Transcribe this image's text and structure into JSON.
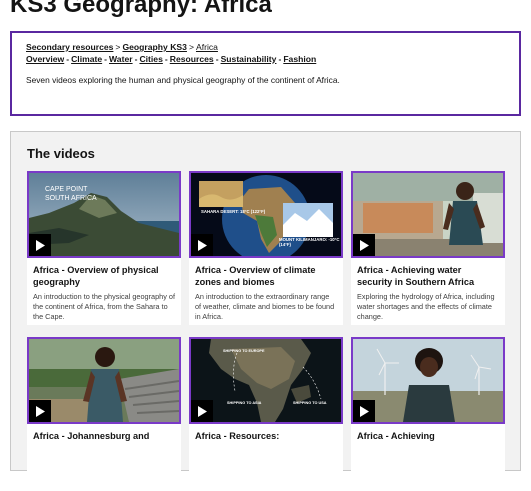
{
  "page": {
    "title": "KS3 Geography: Africa"
  },
  "nav": {
    "breadcrumbs": [
      {
        "label": "Secondary resources"
      },
      {
        "label": "Geography KS3"
      },
      {
        "label": "Africa"
      }
    ],
    "topics": [
      {
        "label": "Overview"
      },
      {
        "label": "Climate"
      },
      {
        "label": "Water"
      },
      {
        "label": "Cities"
      },
      {
        "label": "Resources"
      },
      {
        "label": "Sustainability"
      },
      {
        "label": "Fashion"
      }
    ],
    "description": "Seven videos exploring the human and physical geography of the continent of Africa."
  },
  "videos": {
    "heading": "The videos",
    "cards": [
      {
        "title": "Africa - Overview of physical geography",
        "description": "An introduction to the physical geography of the continent of Africa, from the Sahara to the Cape.",
        "overlay": [
          "CAPE POINT",
          "SOUTH AFRICA"
        ]
      },
      {
        "title": "Africa - Overview of climate zones and biomes",
        "description": "An introduction to the extraordinary range of weather, climate and biomes to be found in Africa.",
        "overlay": [
          "SAHARA DESERT: 18°C (122°F)",
          "MOUNT KILIMANJARO: -10°C (14°F)"
        ]
      },
      {
        "title": "Africa - Achieving water security in Southern Africa",
        "description": "Exploring the hydrology of Africa, including water shortages and the effects of climate change.",
        "overlay": []
      },
      {
        "title": "Africa - Johannesburg and",
        "description": "",
        "overlay": []
      },
      {
        "title": "Africa - Resources:",
        "description": "",
        "overlay": [
          "SHIPPING TO EUROPE",
          "SHIPPING TO ASIA",
          "SHIPPING TO USA"
        ]
      },
      {
        "title": "Africa - Achieving",
        "description": "",
        "overlay": []
      }
    ]
  },
  "colors": {
    "accent_purple": "#5a28a0",
    "thumb_border": "#7a3ac8",
    "section_bg": "#f2f2f2"
  }
}
